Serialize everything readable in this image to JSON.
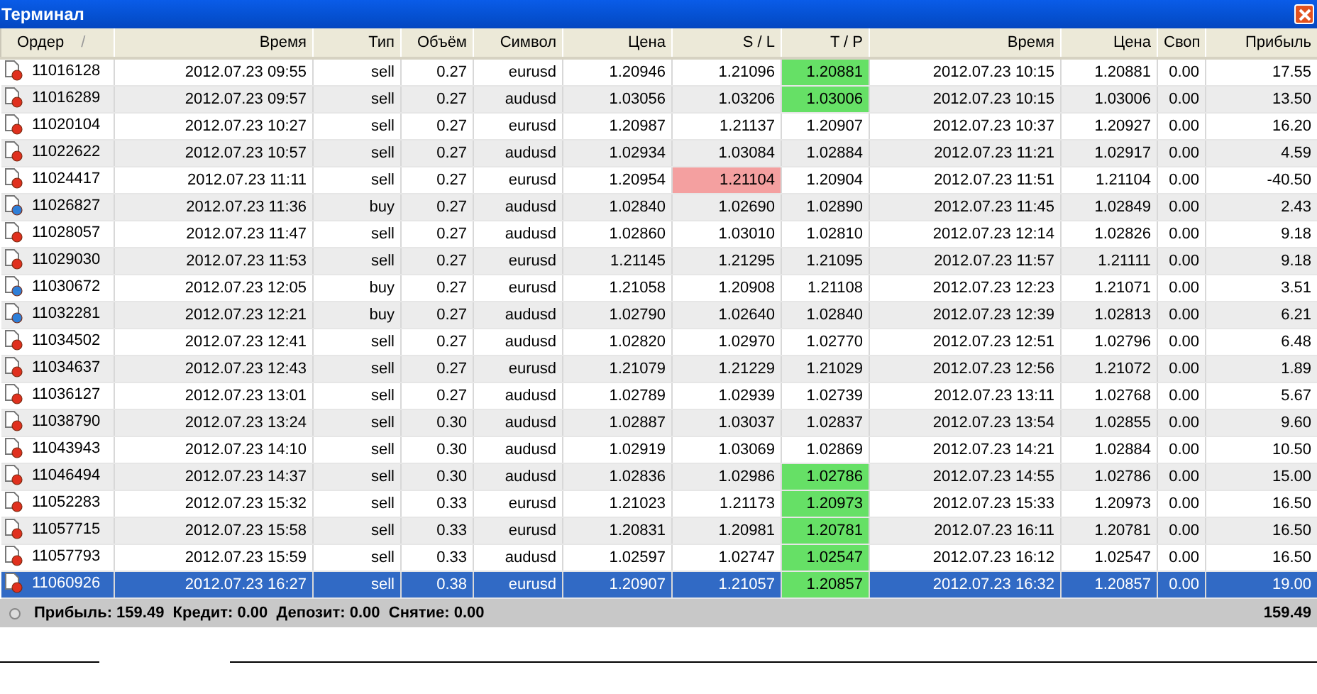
{
  "window": {
    "title": "Терминал"
  },
  "table": {
    "columns": [
      {
        "label": "Ордер",
        "sort": "/"
      },
      {
        "label": "Время"
      },
      {
        "label": "Тип"
      },
      {
        "label": "Объём"
      },
      {
        "label": "Символ"
      },
      {
        "label": "Цена"
      },
      {
        "label": "S / L"
      },
      {
        "label": "T / P"
      },
      {
        "label": "Время"
      },
      {
        "label": "Цена"
      },
      {
        "label": "Своп"
      },
      {
        "label": "Прибыль"
      }
    ],
    "rows": [
      {
        "kind": "sell",
        "selected": false,
        "sl_hit": false,
        "tp_hit": true,
        "cells": [
          "11016128",
          "2012.07.23 09:55",
          "sell",
          "0.27",
          "eurusd",
          "1.20946",
          "1.21096",
          "1.20881",
          "2012.07.23 10:15",
          "1.20881",
          "0.00",
          "17.55"
        ]
      },
      {
        "kind": "sell",
        "selected": false,
        "sl_hit": false,
        "tp_hit": true,
        "cells": [
          "11016289",
          "2012.07.23 09:57",
          "sell",
          "0.27",
          "audusd",
          "1.03056",
          "1.03206",
          "1.03006",
          "2012.07.23 10:15",
          "1.03006",
          "0.00",
          "13.50"
        ]
      },
      {
        "kind": "sell",
        "selected": false,
        "sl_hit": false,
        "tp_hit": false,
        "cells": [
          "11020104",
          "2012.07.23 10:27",
          "sell",
          "0.27",
          "eurusd",
          "1.20987",
          "1.21137",
          "1.20907",
          "2012.07.23 10:37",
          "1.20927",
          "0.00",
          "16.20"
        ]
      },
      {
        "kind": "sell",
        "selected": false,
        "sl_hit": false,
        "tp_hit": false,
        "cells": [
          "11022622",
          "2012.07.23 10:57",
          "sell",
          "0.27",
          "audusd",
          "1.02934",
          "1.03084",
          "1.02884",
          "2012.07.23 11:21",
          "1.02917",
          "0.00",
          "4.59"
        ]
      },
      {
        "kind": "sell",
        "selected": false,
        "sl_hit": true,
        "tp_hit": false,
        "cells": [
          "11024417",
          "2012.07.23 11:11",
          "sell",
          "0.27",
          "eurusd",
          "1.20954",
          "1.21104",
          "1.20904",
          "2012.07.23 11:51",
          "1.21104",
          "0.00",
          "-40.50"
        ]
      },
      {
        "kind": "buy",
        "selected": false,
        "sl_hit": false,
        "tp_hit": false,
        "cells": [
          "11026827",
          "2012.07.23 11:36",
          "buy",
          "0.27",
          "audusd",
          "1.02840",
          "1.02690",
          "1.02890",
          "2012.07.23 11:45",
          "1.02849",
          "0.00",
          "2.43"
        ]
      },
      {
        "kind": "sell",
        "selected": false,
        "sl_hit": false,
        "tp_hit": false,
        "cells": [
          "11028057",
          "2012.07.23 11:47",
          "sell",
          "0.27",
          "audusd",
          "1.02860",
          "1.03010",
          "1.02810",
          "2012.07.23 12:14",
          "1.02826",
          "0.00",
          "9.18"
        ]
      },
      {
        "kind": "sell",
        "selected": false,
        "sl_hit": false,
        "tp_hit": false,
        "cells": [
          "11029030",
          "2012.07.23 11:53",
          "sell",
          "0.27",
          "eurusd",
          "1.21145",
          "1.21295",
          "1.21095",
          "2012.07.23 11:57",
          "1.21111",
          "0.00",
          "9.18"
        ]
      },
      {
        "kind": "buy",
        "selected": false,
        "sl_hit": false,
        "tp_hit": false,
        "cells": [
          "11030672",
          "2012.07.23 12:05",
          "buy",
          "0.27",
          "eurusd",
          "1.21058",
          "1.20908",
          "1.21108",
          "2012.07.23 12:23",
          "1.21071",
          "0.00",
          "3.51"
        ]
      },
      {
        "kind": "buy",
        "selected": false,
        "sl_hit": false,
        "tp_hit": false,
        "cells": [
          "11032281",
          "2012.07.23 12:21",
          "buy",
          "0.27",
          "audusd",
          "1.02790",
          "1.02640",
          "1.02840",
          "2012.07.23 12:39",
          "1.02813",
          "0.00",
          "6.21"
        ]
      },
      {
        "kind": "sell",
        "selected": false,
        "sl_hit": false,
        "tp_hit": false,
        "cells": [
          "11034502",
          "2012.07.23 12:41",
          "sell",
          "0.27",
          "audusd",
          "1.02820",
          "1.02970",
          "1.02770",
          "2012.07.23 12:51",
          "1.02796",
          "0.00",
          "6.48"
        ]
      },
      {
        "kind": "sell",
        "selected": false,
        "sl_hit": false,
        "tp_hit": false,
        "cells": [
          "11034637",
          "2012.07.23 12:43",
          "sell",
          "0.27",
          "eurusd",
          "1.21079",
          "1.21229",
          "1.21029",
          "2012.07.23 12:56",
          "1.21072",
          "0.00",
          "1.89"
        ]
      },
      {
        "kind": "sell",
        "selected": false,
        "sl_hit": false,
        "tp_hit": false,
        "cells": [
          "11036127",
          "2012.07.23 13:01",
          "sell",
          "0.27",
          "audusd",
          "1.02789",
          "1.02939",
          "1.02739",
          "2012.07.23 13:11",
          "1.02768",
          "0.00",
          "5.67"
        ]
      },
      {
        "kind": "sell",
        "selected": false,
        "sl_hit": false,
        "tp_hit": false,
        "cells": [
          "11038790",
          "2012.07.23 13:24",
          "sell",
          "0.30",
          "audusd",
          "1.02887",
          "1.03037",
          "1.02837",
          "2012.07.23 13:54",
          "1.02855",
          "0.00",
          "9.60"
        ]
      },
      {
        "kind": "sell",
        "selected": false,
        "sl_hit": false,
        "tp_hit": false,
        "cells": [
          "11043943",
          "2012.07.23 14:10",
          "sell",
          "0.30",
          "audusd",
          "1.02919",
          "1.03069",
          "1.02869",
          "2012.07.23 14:21",
          "1.02884",
          "0.00",
          "10.50"
        ]
      },
      {
        "kind": "sell",
        "selected": false,
        "sl_hit": false,
        "tp_hit": true,
        "cells": [
          "11046494",
          "2012.07.23 14:37",
          "sell",
          "0.30",
          "audusd",
          "1.02836",
          "1.02986",
          "1.02786",
          "2012.07.23 14:55",
          "1.02786",
          "0.00",
          "15.00"
        ]
      },
      {
        "kind": "sell",
        "selected": false,
        "sl_hit": false,
        "tp_hit": true,
        "cells": [
          "11052283",
          "2012.07.23 15:32",
          "sell",
          "0.33",
          "eurusd",
          "1.21023",
          "1.21173",
          "1.20973",
          "2012.07.23 15:33",
          "1.20973",
          "0.00",
          "16.50"
        ]
      },
      {
        "kind": "sell",
        "selected": false,
        "sl_hit": false,
        "tp_hit": true,
        "cells": [
          "11057715",
          "2012.07.23 15:58",
          "sell",
          "0.33",
          "eurusd",
          "1.20831",
          "1.20981",
          "1.20781",
          "2012.07.23 16:11",
          "1.20781",
          "0.00",
          "16.50"
        ]
      },
      {
        "kind": "sell",
        "selected": false,
        "sl_hit": false,
        "tp_hit": true,
        "cells": [
          "11057793",
          "2012.07.23 15:59",
          "sell",
          "0.33",
          "audusd",
          "1.02597",
          "1.02747",
          "1.02547",
          "2012.07.23 16:12",
          "1.02547",
          "0.00",
          "16.50"
        ]
      },
      {
        "kind": "sell",
        "selected": true,
        "sl_hit": false,
        "tp_hit": true,
        "cells": [
          "11060926",
          "2012.07.23 16:27",
          "sell",
          "0.38",
          "eurusd",
          "1.20907",
          "1.21057",
          "1.20857",
          "2012.07.23 16:32",
          "1.20857",
          "0.00",
          "19.00"
        ]
      }
    ]
  },
  "summary": {
    "text": "Прибыль: 159.49  Кредит: 0.00  Депозит: 0.00  Снятие: 0.00",
    "total": "159.49"
  }
}
